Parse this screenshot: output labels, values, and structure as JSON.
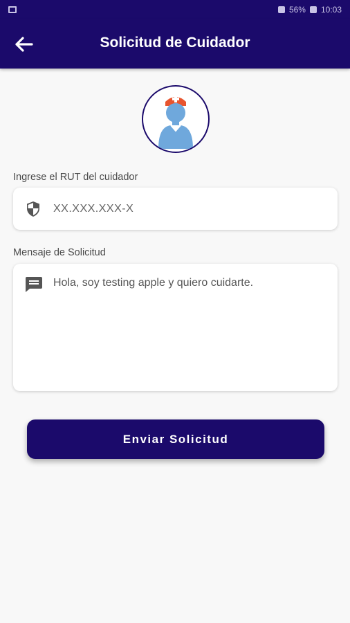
{
  "status_bar": {
    "battery_text": "56%",
    "time": "10:03"
  },
  "app_bar": {
    "title": "Solicitud de Cuidador",
    "back_icon": "arrow-left-icon"
  },
  "avatar": {
    "icon": "nurse-avatar-icon"
  },
  "rut_field": {
    "label": "Ingrese el RUT del cuidador",
    "placeholder": "XX.XXX.XXX-X",
    "value": "",
    "icon": "shield-icon"
  },
  "message_field": {
    "label": "Mensaje de Solicitud",
    "value": "Hola, soy testing apple y quiero cuidarte.",
    "icon": "message-icon"
  },
  "submit": {
    "label": "Enviar Solicitud"
  },
  "colors": {
    "primary": "#1b0a6b",
    "background": "#f8f8f8",
    "nurse_cap": "#e8542e",
    "nurse_body": "#6fa8dc"
  }
}
